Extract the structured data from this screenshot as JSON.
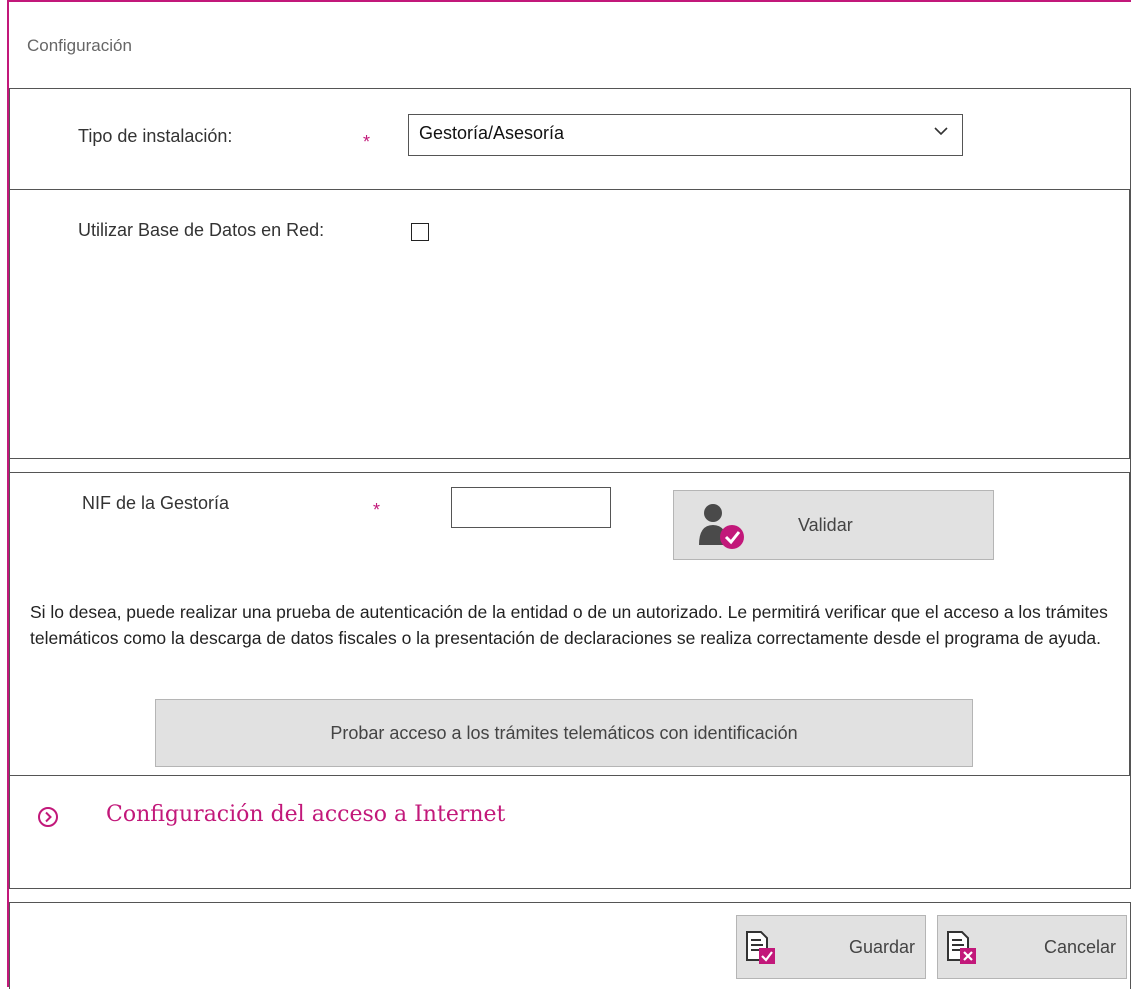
{
  "window": {
    "title": "Configuración"
  },
  "install": {
    "label": "Tipo de instalación:",
    "required_mark": "*",
    "selected": "Gestoría/Asesoría"
  },
  "network_db": {
    "label": "Utilizar Base de Datos en Red:",
    "checked": false
  },
  "nif": {
    "label": "NIF de la Gestoría",
    "required_mark": "*",
    "value": "",
    "validate_label": "Validar"
  },
  "auth_test": {
    "info": "Si lo desea, puede realizar una prueba de autenticación de la entidad o de un autorizado. Le permitirá verificar que el acceso a los trámites telemáticos como la descarga de datos fiscales o la presentación de declaraciones se realiza correctamente desde el programa de ayuda.",
    "button_label": "Probar acceso a los trámites telemáticos con identificación"
  },
  "internet": {
    "label": "Configuración del acceso a Internet"
  },
  "footer": {
    "save_label": "Guardar",
    "cancel_label": "Cancelar"
  },
  "colors": {
    "accent": "#c2187a",
    "button_bg": "#e1e1e1",
    "border": "#555555"
  },
  "icons": {
    "validate": "user-check-icon",
    "save": "document-check-icon",
    "cancel": "document-cancel-icon",
    "expand": "chevron-right-circle-icon",
    "select": "chevron-down-icon"
  }
}
